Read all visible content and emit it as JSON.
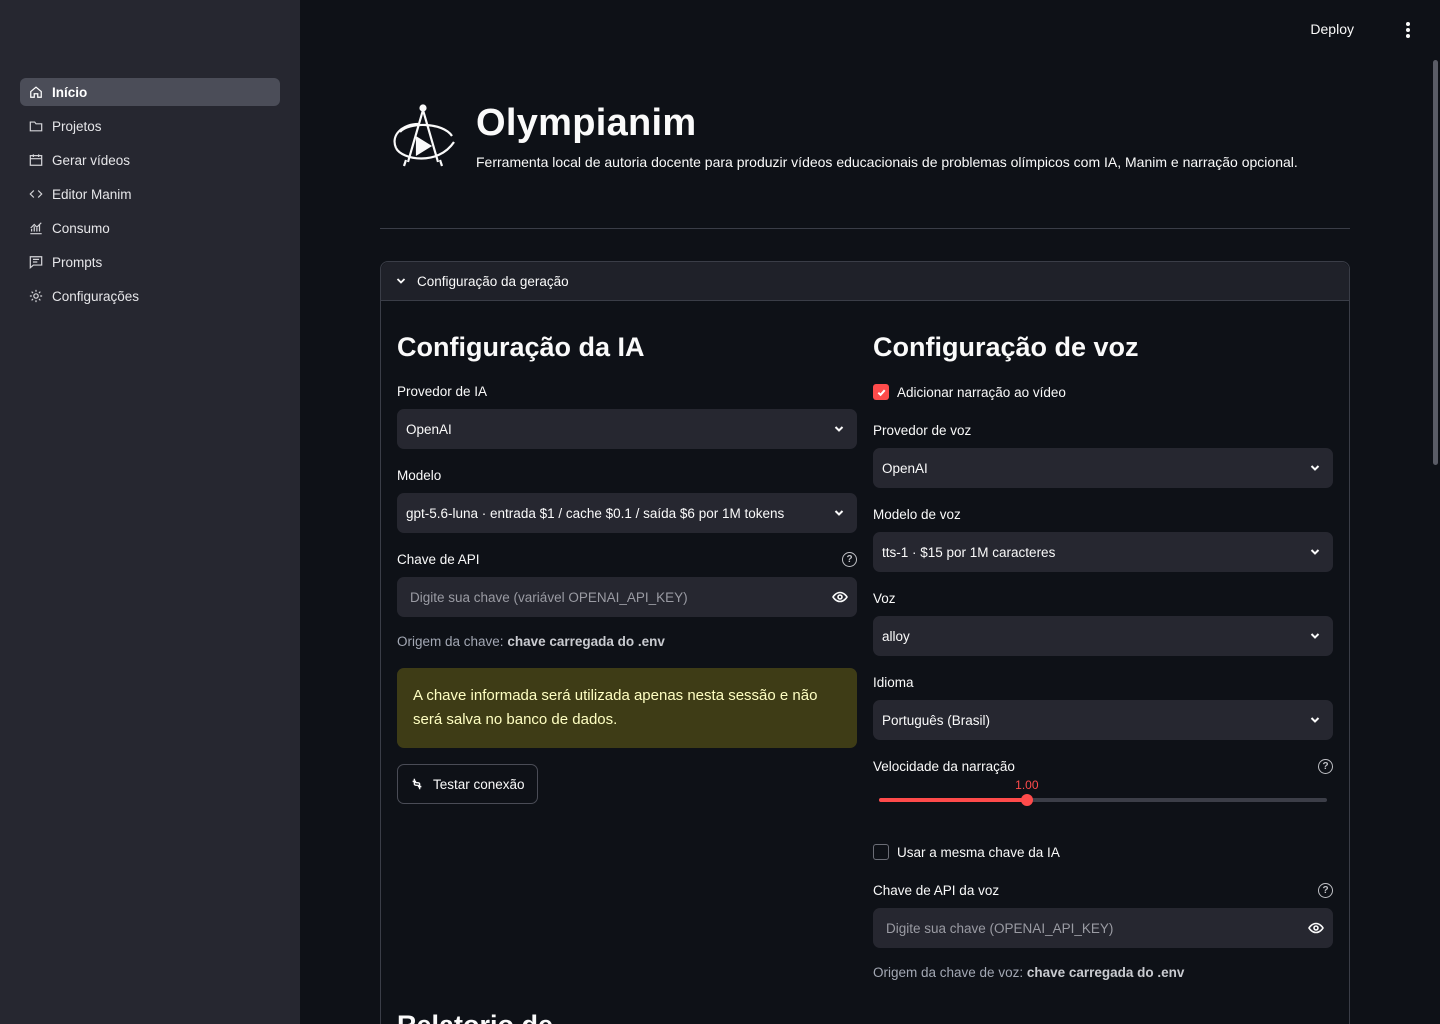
{
  "sidebar": {
    "items": [
      {
        "label": "Início",
        "icon": "home-icon",
        "active": true
      },
      {
        "label": "Projetos",
        "icon": "folder-icon",
        "active": false
      },
      {
        "label": "Gerar vídeos",
        "icon": "calendar-icon",
        "active": false
      },
      {
        "label": "Editor Manim",
        "icon": "code-icon",
        "active": false
      },
      {
        "label": "Consumo",
        "icon": "chart-icon",
        "active": false
      },
      {
        "label": "Prompts",
        "icon": "message-icon",
        "active": false
      },
      {
        "label": "Configurações",
        "icon": "gear-icon",
        "active": false
      }
    ]
  },
  "topbar": {
    "deploy_label": "Deploy",
    "menu_icon": "more-vertical-icon"
  },
  "header": {
    "title": "Olympianim",
    "subtitle": "Ferramenta local de autoria docente para produzir vídeos educacionais de problemas olímpicos com IA, Manim e narração opcional."
  },
  "expander": {
    "label": "Configuração da geração"
  },
  "ai": {
    "heading": "Configuração da IA",
    "provider_label": "Provedor de IA",
    "provider_value": "OpenAI",
    "model_label": "Modelo",
    "model_value": "gpt-5.6-luna · entrada $1 / cache $0.1 / saída $6 por 1M tokens",
    "api_key_label": "Chave de API",
    "api_key_placeholder": "Digite sua chave (variável OPENAI_API_KEY)",
    "origin_prefix": "Origem da chave:",
    "origin_value": "chave carregada do .env",
    "warning": "A chave informada será utilizada apenas nesta sessão e não será salva no banco de dados.",
    "test_button": "Testar conexão"
  },
  "voice": {
    "heading": "Configuração de voz",
    "narration_label": "Adicionar narração ao vídeo",
    "narration_checked": true,
    "provider_label": "Provedor de voz",
    "provider_value": "OpenAI",
    "model_label": "Modelo de voz",
    "model_value": "tts-1 · $15 por 1M caracteres",
    "voice_label": "Voz",
    "voice_value": "alloy",
    "language_label": "Idioma",
    "language_value": "Português (Brasil)",
    "speed_label": "Velocidade da narração",
    "speed_value": "1.00",
    "speed_fraction": 0.33,
    "same_key_label": "Usar a mesma chave da IA",
    "same_key_checked": false,
    "api_key_label": "Chave de API da voz",
    "api_key_placeholder": "Digite sua chave (OPENAI_API_KEY)",
    "origin_prefix": "Origem da chave de voz:",
    "origin_value": "chave carregada do .env"
  },
  "next_section": {
    "heading_partial": "Relatorio de"
  },
  "colors": {
    "accent": "#ff4b4b",
    "sidebar": "#262730",
    "background": "#0e1117",
    "warning_bg": "#3e3c16"
  }
}
